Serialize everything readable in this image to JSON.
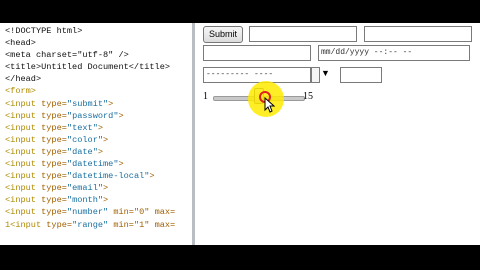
{
  "editor": {
    "lines": [
      {
        "kind": "plain",
        "text": "<!DOCTYPE html>"
      },
      {
        "kind": "plain",
        "text": "<head>"
      },
      {
        "kind": "plain",
        "text": "<meta charset=\"utf-8\" />"
      },
      {
        "kind": "plain",
        "text": "<title>Untitled Document</title>"
      },
      {
        "kind": "plain",
        "text": "</head>"
      },
      {
        "kind": "tagonly",
        "tag": "<form>"
      },
      {
        "kind": "input",
        "tag": "<input",
        "attr": " type=",
        "val": "\"submit\"",
        "tail": ">"
      },
      {
        "kind": "input",
        "tag": "<input",
        "attr": " type=",
        "val": "\"password\"",
        "tail": ">"
      },
      {
        "kind": "input",
        "tag": "<input",
        "attr": " type=",
        "val": "\"text\"",
        "tail": ">"
      },
      {
        "kind": "input",
        "tag": "<input",
        "attr": " type=",
        "val": "\"color\"",
        "tail": ">"
      },
      {
        "kind": "input",
        "tag": "<input",
        "attr": " type=",
        "val": "\"date\"",
        "tail": ">"
      },
      {
        "kind": "input",
        "tag": "<input",
        "attr": " type=",
        "val": "\"datetime\"",
        "tail": ">"
      },
      {
        "kind": "input",
        "tag": "<input",
        "attr": " type=",
        "val": "\"datetime-local\"",
        "tail": ">"
      },
      {
        "kind": "input",
        "tag": "<input",
        "attr": " type=",
        "val": "\"email\"",
        "tail": ">"
      },
      {
        "kind": "input",
        "tag": "<input",
        "attr": " type=",
        "val": "\"month\"",
        "tail": ">"
      },
      {
        "kind": "input",
        "tag": "<input",
        "attr": " type=",
        "val": "\"number\"",
        "tail": " min=\"0\" max="
      },
      {
        "kind": "input",
        "tag": "1<input",
        "attr": " type=",
        "val": "\"range\"",
        "tail": " min=\"1\" max="
      }
    ]
  },
  "preview": {
    "submit_label": "Submit",
    "date_placeholder": "mm/dd/yyyy --:-- --",
    "datetime_placeholder": "--------- ----",
    "month_arrow": "▼",
    "range_min_label": "1",
    "range_max_label": "15",
    "range_value_fraction": 0.5
  }
}
